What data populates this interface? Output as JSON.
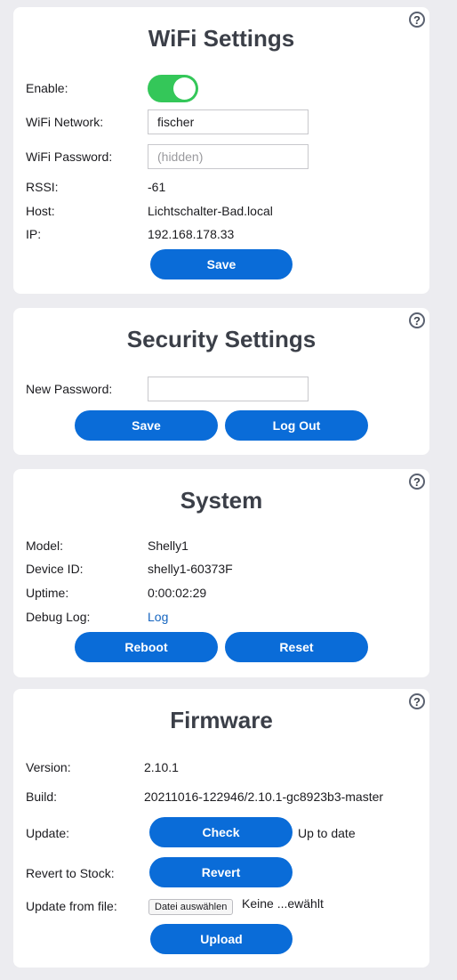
{
  "help_icon": "?",
  "wifi": {
    "title": "WiFi Settings",
    "enable_label": "Enable:",
    "enabled": true,
    "network_label": "WiFi Network:",
    "network_value": "fischer",
    "password_label": "WiFi Password:",
    "password_placeholder": "(hidden)",
    "rssi_label": "RSSI:",
    "rssi_value": "-61",
    "host_label": "Host:",
    "host_value": "Lichtschalter-Bad.local",
    "ip_label": "IP:",
    "ip_value": "192.168.178.33",
    "save_label": "Save"
  },
  "security": {
    "title": "Security Settings",
    "password_label": "New Password:",
    "password_value": "",
    "save_label": "Save",
    "logout_label": "Log Out"
  },
  "system": {
    "title": "System",
    "model_label": "Model:",
    "model_value": "Shelly1",
    "device_id_label": "Device ID:",
    "device_id_value": "shelly1-60373F",
    "uptime_label": "Uptime:",
    "uptime_value": "0:00:02:29",
    "debug_label": "Debug Log:",
    "debug_link": "Log",
    "reboot_label": "Reboot",
    "reset_label": "Reset"
  },
  "firmware": {
    "title": "Firmware",
    "version_label": "Version:",
    "version_value": "2.10.1",
    "build_label": "Build:",
    "build_value": "20211016-122946/2.10.1-gc8923b3-master",
    "update_label": "Update:",
    "check_label": "Check",
    "update_status": "Up to date",
    "revert_label": "Revert to Stock:",
    "revert_button": "Revert",
    "file_label": "Update from file:",
    "choose_file_label": "Datei auswählen",
    "file_status": "Keine ...ewählt",
    "upload_label": "Upload"
  },
  "colors": {
    "accent": "#0a6cd8",
    "toggle_on": "#34c759",
    "background": "#ececf0",
    "card": "#ffffff",
    "link": "#1565c0"
  }
}
